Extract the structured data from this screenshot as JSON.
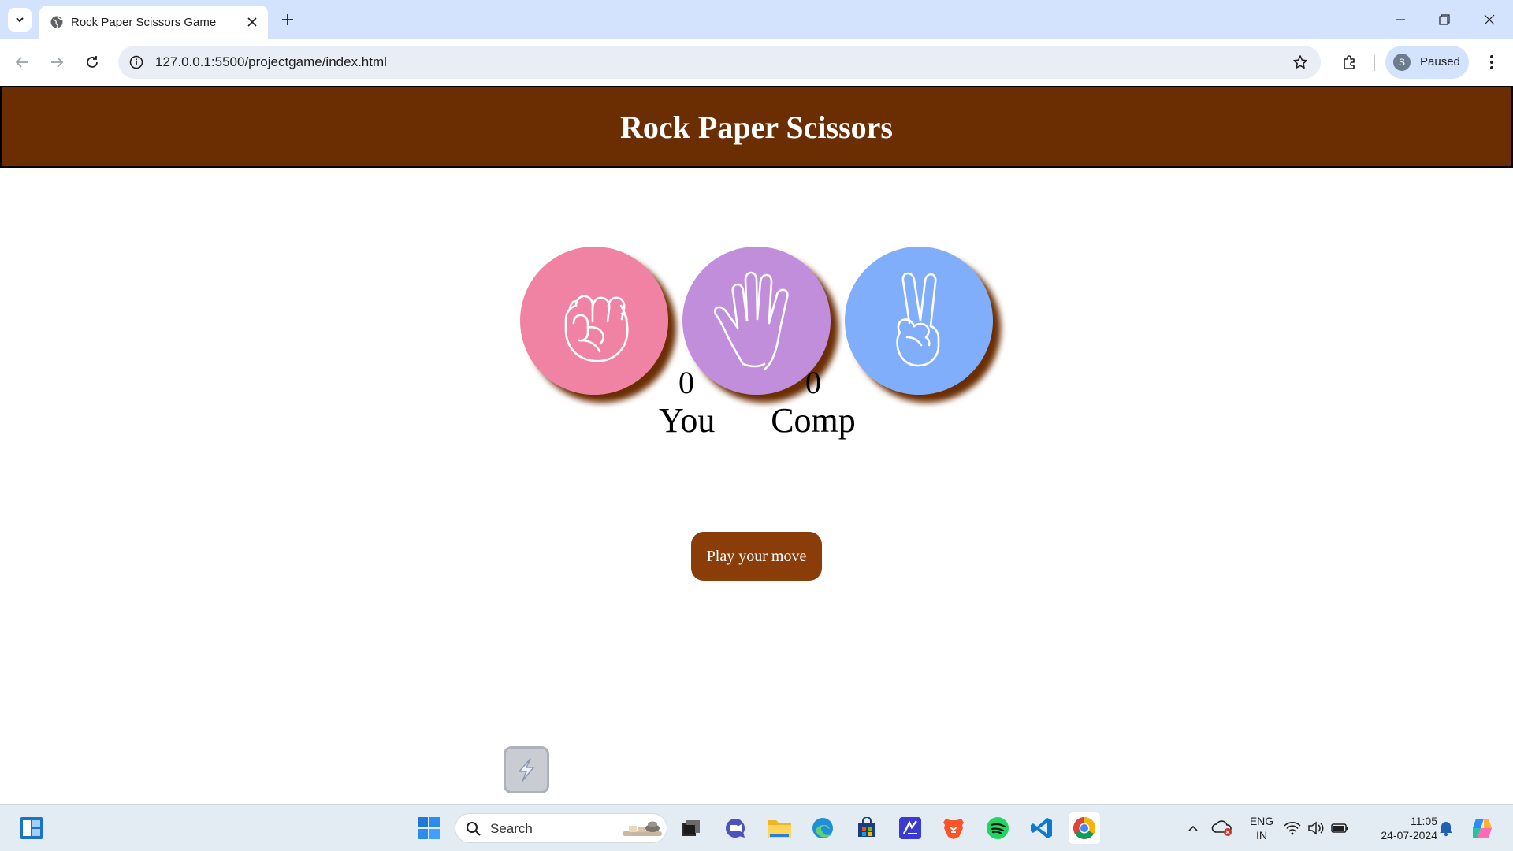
{
  "browser": {
    "tab_title": "Rock Paper Scissors Game",
    "url": "127.0.0.1:5500/projectgame/index.html",
    "profile_initial": "S",
    "profile_status": "Paused"
  },
  "game": {
    "title": "Rock Paper Scissors",
    "choices": [
      {
        "name": "rock",
        "color": "#f083a4"
      },
      {
        "name": "paper",
        "color": "#c18edb"
      },
      {
        "name": "scissors",
        "color": "#80aefb"
      }
    ],
    "user_score": "0",
    "user_label": "You",
    "comp_score": "0",
    "comp_label": "Comp",
    "play_button": "Play your move",
    "header_color": "#6b2e03",
    "button_color": "#8a3d09"
  },
  "taskbar": {
    "search_label": "Search",
    "language_line1": "ENG",
    "language_line2": "IN",
    "time": "11:05",
    "date": "24-07-2024"
  }
}
